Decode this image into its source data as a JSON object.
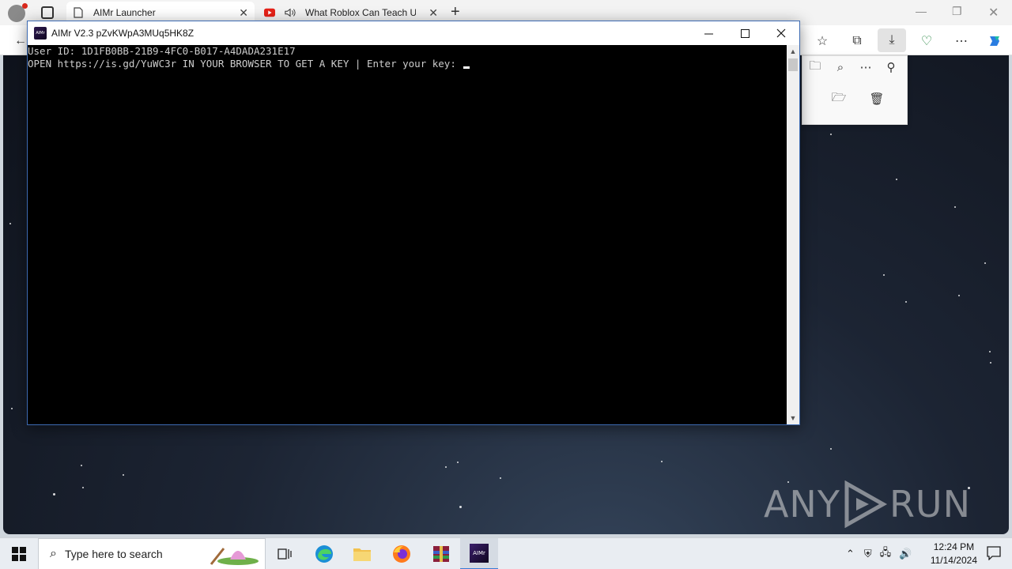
{
  "browser": {
    "tabs": [
      {
        "title": "AIMr Launcher"
      },
      {
        "title": "What Roblox Can Teach Us"
      }
    ]
  },
  "console": {
    "title": "AIMr V2.3 pZvKWpA3MUq5HK8Z",
    "app_icon_text": "AIMr",
    "lines": [
      "User ID: 1D1FB0BB-21B9-4FC0-B017-A4DADA231E17",
      "OPEN https://is.gd/YuWC3r IN YOUR BROWSER TO GET A KEY | Enter your key: "
    ]
  },
  "taskbar": {
    "search_placeholder": "Type here to search",
    "time": "12:24 PM",
    "date": "11/14/2024"
  },
  "watermark": {
    "left": "ANY",
    "right": "RUN"
  },
  "colors": {
    "accent": "#3a7bd5",
    "console_bg": "#000000",
    "console_text": "#cccccc"
  }
}
